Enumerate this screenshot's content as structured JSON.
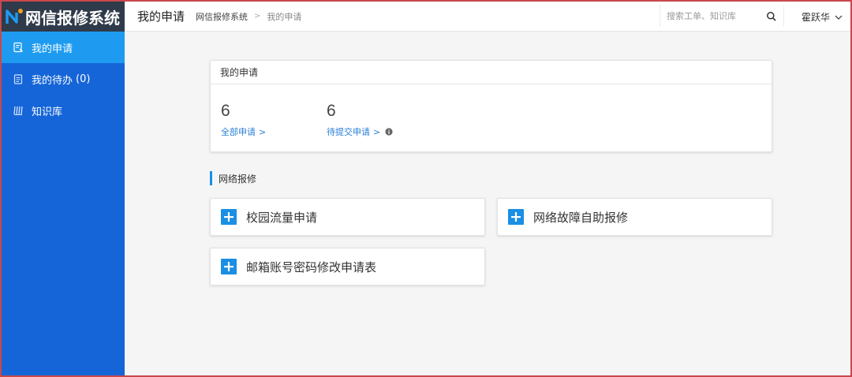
{
  "app": {
    "logo_text": "网信报修系统"
  },
  "sidebar": {
    "items": [
      {
        "label": "我的申请",
        "count": ""
      },
      {
        "label": "我的待办",
        "count": "(0)"
      },
      {
        "label": "知识库",
        "count": ""
      }
    ]
  },
  "header": {
    "title": "我的申请",
    "breadcrumb": {
      "root": "网信报修系统",
      "separator": ">",
      "current": "我的申请"
    },
    "search": {
      "value": "",
      "placeholder": "搜索工单、知识库"
    },
    "user": {
      "name": "霍跃华"
    }
  },
  "summary": {
    "title": "我的申请",
    "stats": [
      {
        "value": "6",
        "label": "全部申请",
        "arrow": ">"
      },
      {
        "value": "6",
        "label": "待提交申请",
        "arrow": ">"
      }
    ]
  },
  "section": {
    "title": "网络报修",
    "cards": [
      {
        "label": "校园流量申请"
      },
      {
        "label": "网络故障自助报修"
      },
      {
        "label": "邮箱账号密码修改申请表"
      }
    ]
  },
  "colors": {
    "sidebar": "#1565d8",
    "sidebar_active": "#1e9bf0",
    "logo_bg": "#2f3a4a",
    "link": "#2a7fd4",
    "plus_icon": "#1a8fe3",
    "frame_border": "#c8484b"
  }
}
